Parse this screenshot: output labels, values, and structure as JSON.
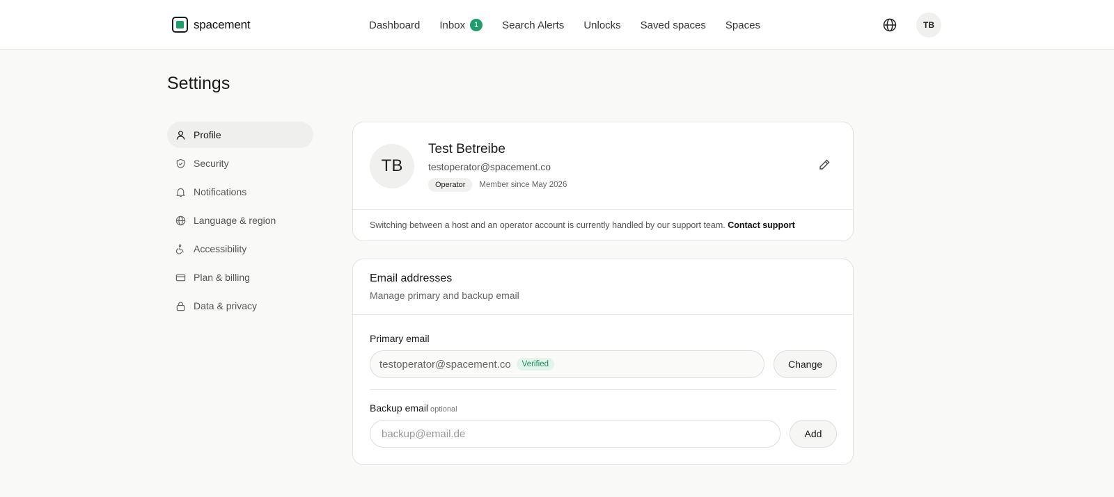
{
  "brand": {
    "name": "spacement",
    "accent": "#1f9d6c"
  },
  "nav": {
    "items": [
      {
        "label": "Dashboard"
      },
      {
        "label": "Inbox",
        "badge": "1"
      },
      {
        "label": "Search Alerts"
      },
      {
        "label": "Unlocks"
      },
      {
        "label": "Saved spaces"
      },
      {
        "label": "Spaces"
      }
    ],
    "language_icon": "globe-icon",
    "user_initials": "TB"
  },
  "page": {
    "title": "Settings"
  },
  "sidebar": {
    "items": [
      {
        "label": "Profile",
        "icon": "user-icon",
        "active": true
      },
      {
        "label": "Security",
        "icon": "shield-icon"
      },
      {
        "label": "Notifications",
        "icon": "bell-icon"
      },
      {
        "label": "Language & region",
        "icon": "globe-icon"
      },
      {
        "label": "Accessibility",
        "icon": "accessibility-icon"
      },
      {
        "label": "Plan & billing",
        "icon": "credit-card-icon"
      },
      {
        "label": "Data & privacy",
        "icon": "lock-icon"
      }
    ]
  },
  "profile": {
    "initials": "TB",
    "name": "Test Betreibe",
    "email": "testoperator@spacement.co",
    "role": "Operator",
    "member_since": "Member since May 2026",
    "notice": "Switching between a host and an operator account is currently handled by our support team.",
    "notice_link": "Contact support"
  },
  "email_section": {
    "title": "Email addresses",
    "subtitle": "Manage primary and backup email",
    "primary_label": "Primary email",
    "primary_value": "testoperator@spacement.co",
    "primary_status": "Verified",
    "primary_button": "Change",
    "backup_label": "Backup email",
    "backup_optional": "optional",
    "backup_placeholder": "backup@email.de",
    "backup_button": "Add"
  }
}
